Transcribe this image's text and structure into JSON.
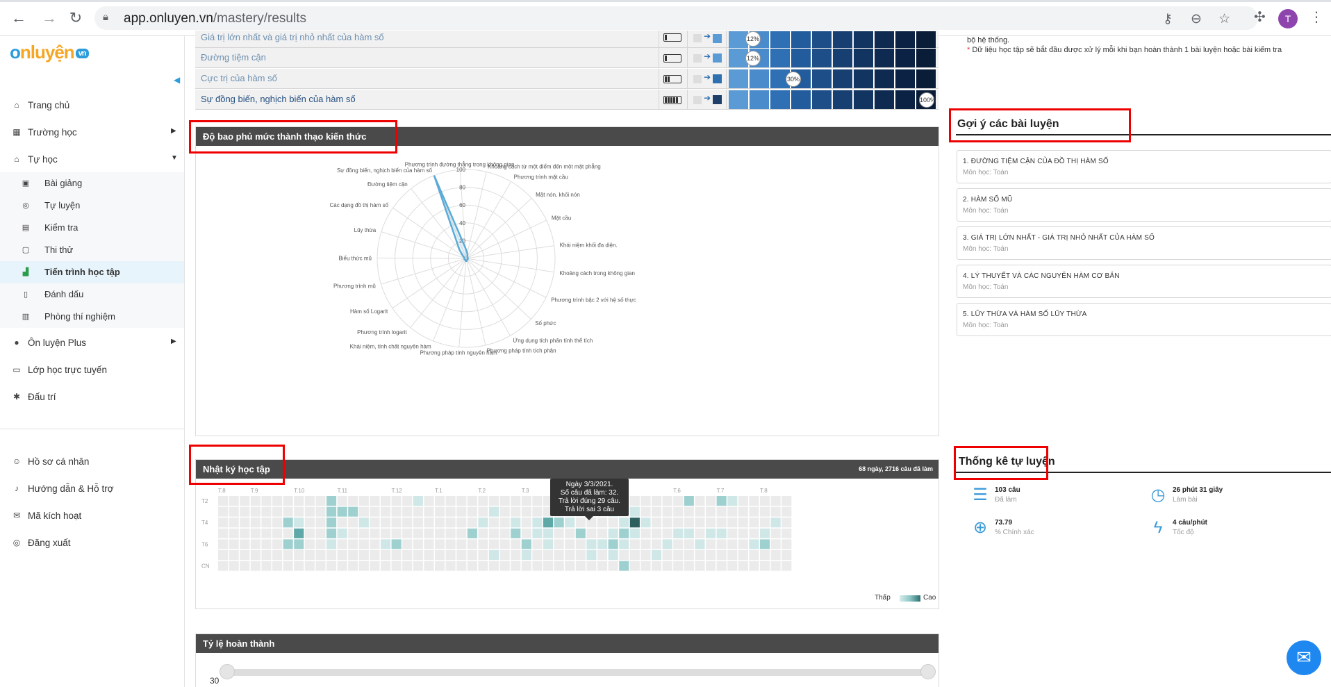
{
  "browser": {
    "url_host": "app.onluyen.vn",
    "url_path": "/mastery/results",
    "avatar_letter": "T"
  },
  "sidebar": {
    "logo_main": "nluyện",
    "logo_prefix": "o",
    "logo_suffix": "vn",
    "items": [
      {
        "label": "Trang chủ",
        "icon": "home-icon"
      },
      {
        "label": "Trường học",
        "icon": "school-icon"
      },
      {
        "label": "Tự học",
        "icon": "graduation-cap-icon"
      }
    ],
    "subitems": [
      {
        "label": "Bài giảng",
        "icon": "video-icon"
      },
      {
        "label": "Tự luyện",
        "icon": "target-icon"
      },
      {
        "label": "Kiểm tra",
        "icon": "clipboard-icon"
      },
      {
        "label": "Thi thử",
        "icon": "calendar-icon"
      },
      {
        "label": "Tiến trình học tập",
        "icon": "bar-chart-icon"
      },
      {
        "label": "Đánh dấu",
        "icon": "bookmark-icon"
      },
      {
        "label": "Phòng thí nghiệm",
        "icon": "lab-icon"
      }
    ],
    "items2": [
      {
        "label": "Ôn luyện Plus",
        "icon": "plus-icon"
      },
      {
        "label": "Lớp học trực tuyến",
        "icon": "monitor-icon"
      },
      {
        "label": "Đấu trí",
        "icon": "bug-icon"
      }
    ],
    "bottom": [
      {
        "label": "Hồ sơ cá nhân",
        "icon": "user-icon"
      },
      {
        "label": "Hướng dẫn & Hỗ trợ",
        "icon": "help-icon"
      },
      {
        "label": "Mã kích hoạt",
        "icon": "key-icon"
      },
      {
        "label": "Đăng xuất",
        "icon": "logout-icon"
      }
    ]
  },
  "mastery_rows": [
    {
      "name": "Giá trị lớn nhất và giá trị nhỏ nhất của hàm số",
      "pct": "12%"
    },
    {
      "name": "Đường tiệm cận",
      "pct": "12%"
    },
    {
      "name": "Cực trị của hàm số",
      "pct": "30%"
    },
    {
      "name": "Sự đồng biến, nghịch biến của hàm số",
      "pct": "100%"
    }
  ],
  "radar": {
    "title": "Độ bao phủ mức thành thạo kiến thức",
    "ticks": [
      "20",
      "40",
      "60",
      "80",
      "100"
    ],
    "axes": [
      "Phương trình đường thẳng trong không gian",
      "Khoảng cách từ một điểm đến một mặt phẳng",
      "Phương trình mặt cầu",
      "Mặt nón, khối nón",
      "Mặt cầu",
      "Khái niệm khối đa diện.",
      "Khoảng cách trong không gian",
      "Phương trình bậc 2 với hệ số thực",
      "Số phức",
      "Ứng dụng tích phân tính thể tích",
      "Phương pháp tính tích phân",
      "Phương pháp tính nguyên hàm",
      "Khái niệm, tính chất nguyên hàm",
      "Phương trình logarit",
      "Hàm số Logarit",
      "Phương trình mũ",
      "Biểu thức mũ",
      "Lũy thừa",
      "Các dạng đồ thị hàm số",
      "Đường tiệm cận",
      "Sự đồng biến, nghịch biến của hàm số"
    ],
    "values": [
      12,
      6,
      3,
      2,
      2,
      2,
      2,
      2,
      2,
      2,
      3,
      3,
      2,
      2,
      2,
      2,
      2,
      2,
      4,
      12,
      100
    ]
  },
  "journal": {
    "title": "Nhật ký học tập",
    "summary": "68 ngày, 2716 câu đã làm",
    "months": [
      "T.8",
      "T.9",
      "T.10",
      "T.11",
      "T.12",
      "T.1",
      "T.2",
      "T.3",
      "T.4",
      "T.5",
      "T.6",
      "T.7",
      "T.8"
    ],
    "days": [
      "T2",
      "",
      "T4",
      "",
      "T6",
      "",
      "CN"
    ],
    "tooltip": [
      "Ngày 3/3/2021.",
      "Số câu đã làm: 32.",
      "Trả lời đúng 29 câu.",
      "Trả lời sai 3 câu"
    ],
    "legend_low": "Thấp",
    "legend_high": "Cao",
    "colors": [
      "#ebebeb",
      "#cfe7e7",
      "#9fd0d0",
      "#5fa8a8",
      "#2f6060"
    ]
  },
  "completion": {
    "title": "Tỷ lệ hoàn thành",
    "y_tick": "30"
  },
  "right": {
    "note1": "bộ hệ thống.",
    "note2_star": "*",
    "note2": "Dữ liệu học tập sẽ bắt đầu được xử lý mỗi khi bạn hoàn thành 1 bài luyện hoặc bài kiểm tra",
    "suggest_title": "Gợi ý các bài luyện",
    "suggestions": [
      {
        "title": "1. ĐƯỜNG TIỆM CẬN CỦA ĐỒ THỊ HÀM SỐ",
        "subject": "Môn học: Toán"
      },
      {
        "title": "2. HÀM SỐ MŨ",
        "subject": "Môn học: Toán"
      },
      {
        "title": "3. GIÁ TRỊ LỚN NHẤT - GIÁ TRỊ NHỎ NHẤT CỦA HÀM SỐ",
        "subject": "Môn học: Toán"
      },
      {
        "title": "4. LÝ THUYẾT VÀ CÁC NGUYÊN HÀM CƠ BẢN",
        "subject": "Môn học: Toán"
      },
      {
        "title": "5. LŨY THỪA VÀ HÀM SỐ LŨY THỪA",
        "subject": "Môn học: Toán"
      }
    ],
    "stats_title": "Thống kê tự luyện",
    "stats": [
      {
        "value": "103 câu",
        "unit": "Đã làm",
        "icon": "list-icon"
      },
      {
        "value": "26 phút 31 giây",
        "unit": "Làm bài",
        "icon": "clock-icon"
      },
      {
        "value": "73.79",
        "unit": "% Chính xác",
        "icon": "crosshair-icon"
      },
      {
        "value": "4 câu/phút",
        "unit": "Tốc độ",
        "icon": "lightning-icon"
      }
    ]
  }
}
